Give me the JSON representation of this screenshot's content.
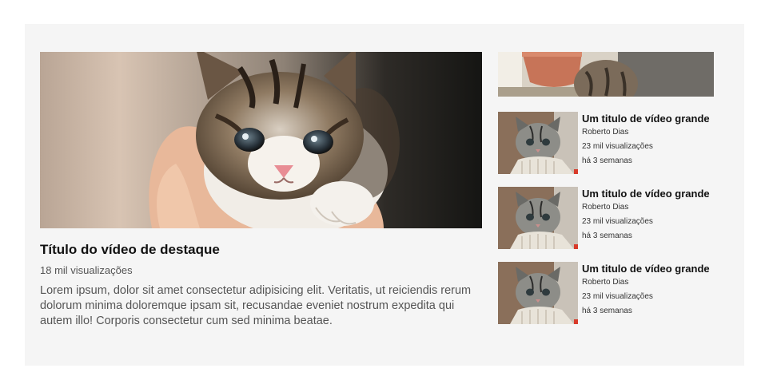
{
  "featured": {
    "title": "Título do vídeo de destaque",
    "views": "18 mil visualizações",
    "description": "Lorem ipsum, dolor sit amet consectetur adipisicing elit. Veritatis, ut reiciendis rerum dolorum minima doloremque ipsam sit, recusandae eveniet nostrum expedita qui autem illo! Corporis consectetur cum sed minima beatae."
  },
  "videos": [
    {
      "title": "Um titulo de vídeo grande",
      "channel": "Roberto Dias",
      "views": "23 mil visualizações",
      "age": "há 3 semanas"
    },
    {
      "title": "Um titulo de vídeo grande",
      "channel": "Roberto Dias",
      "views": "23 mil visualizações",
      "age": "há 3 semanas"
    },
    {
      "title": "Um titulo de vídeo grande",
      "channel": "Roberto Dias",
      "views": "23 mil visualizações",
      "age": "há 3 semanas"
    }
  ]
}
